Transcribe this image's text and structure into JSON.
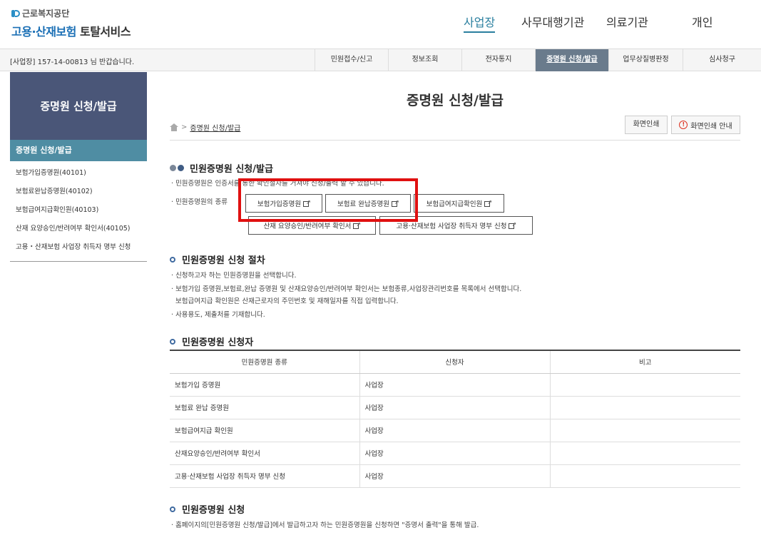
{
  "header": {
    "org": "근로복지공단",
    "service_blue": "고용·산재보험",
    "service_dark": "토탈서비스",
    "nav": [
      "사업장",
      "사무대행기관",
      "의료기관",
      "개인"
    ]
  },
  "gnb": {
    "user_prefix": "[사업장] 157-14-00813",
    "user_suffix": "님 반갑습니다.",
    "tabs": [
      "민원접수/신고",
      "정보조회",
      "전자통지",
      "증명원 신청/발급",
      "업무상질병판정",
      "심사청구"
    ]
  },
  "sidebar": {
    "title": "증명원 신청/발급",
    "active": "증명원 신청/발급",
    "items": [
      "보험가입증명원(40101)",
      "보험료완납증명원(40102)",
      "보험급여지급확인원(40103)",
      "산재 요양승인/반려여부 확인서(40105)",
      "고용・산재보험 사업장 취득자 명부 신청"
    ]
  },
  "main": {
    "title": "증명원 신청/발급",
    "breadcrumb": "증명원 신청/발급",
    "print_button": "화면인쇄",
    "print_guide_button": "화면인쇄 안내",
    "section1": {
      "heading": "민원증명원 신청/발급",
      "desc": "민원증명원은 인증서를 통한 확인절차를 거쳐야 신청/출력 할 수 있습니다.",
      "types_label": "민원증명원의 종류",
      "buttons": [
        "보험가입증명원",
        "보험료 완납증명원",
        "보험급여지급확인원",
        "산재 요양승인/반려여부 확인서",
        "고용·산재보험 사업장 취득자 명부 신청"
      ]
    },
    "section2": {
      "heading": "민원증명원 신청 절차",
      "lines": [
        "신청하고자 하는 민원증명원을 선택합니다.",
        "보험가입 증명원,보험료,완납 증명원 및 산재요양승인/반려여부 확인서는 보험종류,사업장관리번호를 목록에서 선택합니다.",
        "보험급여지급 확인원은 산재근로자의 주민번호 및 재해일자를 직접 입력합니다.",
        "사용용도, 제출처를 기재합니다."
      ]
    },
    "section3": {
      "heading": "민원증명원 신청자",
      "columns": [
        "민원증명원 종류",
        "신청자",
        "비고"
      ],
      "rows": [
        [
          "보험가입 증명원",
          "사업장",
          ""
        ],
        [
          "보험료 완납 증명원",
          "사업장",
          ""
        ],
        [
          "보험급여지급 확인원",
          "사업장",
          ""
        ],
        [
          "산재요양승인/반려여부 확인서",
          "사업장",
          ""
        ],
        [
          "고용·산재보험 사업장 취득자 명부 신청",
          "사업장",
          ""
        ]
      ]
    },
    "section4": {
      "heading": "민원증명원 신청",
      "desc": "홈페이지의[민원증명원 신청/발급]에서 발급하고자 하는 민원증명원을 신청하면 \"증명서 출력\"을 통해 발급."
    }
  },
  "colors": {
    "sidebar_title_bg": "#4a5678",
    "sidebar_active_bg": "#4f8da3",
    "gnb_active_bg": "#6a7b8c",
    "nav_active": "#2a7f9f",
    "highlight_box": "#e01010"
  }
}
